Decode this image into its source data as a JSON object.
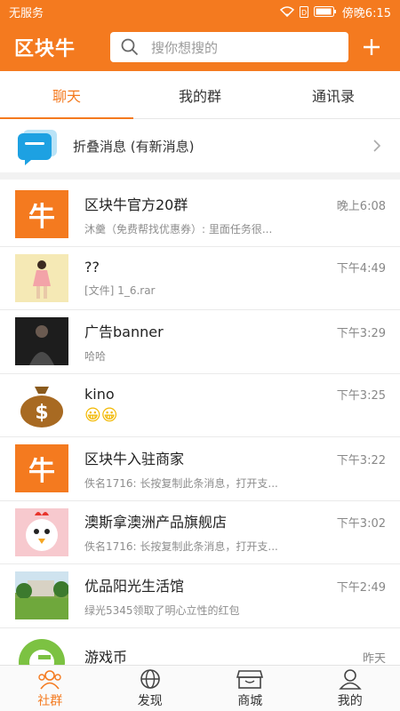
{
  "status": {
    "carrier": "无服务",
    "time": "傍晚6:15",
    "battery": "D"
  },
  "header": {
    "logo": "区块牛",
    "search_placeholder": "搜你想搜的"
  },
  "tabs": [
    {
      "label": "聊天",
      "active": true
    },
    {
      "label": "我的群"
    },
    {
      "label": "通讯录"
    }
  ],
  "folded": {
    "label": "折叠消息 (有新消息)"
  },
  "chats": [
    {
      "name": "区块牛官方20群",
      "time": "晚上6:08",
      "preview": "沐羹（免费帮找优惠券）: 里面任务很...",
      "avatar": "牛"
    },
    {
      "name": "??",
      "time": "下午4:49",
      "preview": "[文件] 1_6.rar"
    },
    {
      "name": "广告banner",
      "time": "下午3:29",
      "preview": "哈哈"
    },
    {
      "name": "kino",
      "time": "下午3:25",
      "preview": "😀😀"
    },
    {
      "name": "区块牛入驻商家",
      "time": "下午3:22",
      "preview": "佚名1716: 长按复制此条消息，打开支...",
      "avatar": "牛"
    },
    {
      "name": "澳斯拿澳洲产品旗舰店",
      "time": "下午3:02",
      "preview": "佚名1716: 长按复制此条消息，打开支..."
    },
    {
      "name": "优品阳光生活馆",
      "time": "下午2:49",
      "preview": "绿光5345领取了明心立性的红包"
    },
    {
      "name": "游戏币",
      "time": "昨天",
      "preview": ""
    }
  ],
  "bottom_nav": [
    {
      "label": "社群",
      "active": true
    },
    {
      "label": "发现"
    },
    {
      "label": "商城"
    },
    {
      "label": "我的"
    }
  ],
  "colors": {
    "accent": "#f47a1f"
  }
}
